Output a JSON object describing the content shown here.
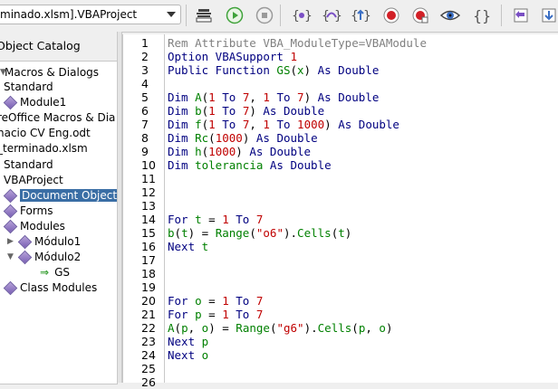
{
  "toolbar": {
    "module_selector_value": "minado.xlsm].VBAProject",
    "buttons": [
      {
        "name": "compile-button",
        "icon": "compile-icon"
      },
      {
        "name": "run-button",
        "icon": "run-icon"
      },
      {
        "name": "stop-button",
        "icon": "stop-icon"
      },
      {
        "name": "step-into-button",
        "icon": "step-into-icon"
      },
      {
        "name": "step-over-button",
        "icon": "step-over-icon"
      },
      {
        "name": "step-out-button",
        "icon": "step-out-icon"
      },
      {
        "name": "breakpoint-button",
        "icon": "breakpoint-icon"
      },
      {
        "name": "manage-breakpoints-button",
        "icon": "manage-breakpoints-icon"
      },
      {
        "name": "enable-watch-button",
        "icon": "watch-icon"
      },
      {
        "name": "find-parentheses-button",
        "icon": "brackets-icon"
      },
      {
        "name": "insert-button",
        "icon": "insert-icon"
      },
      {
        "name": "save-button",
        "icon": "save-icon"
      }
    ],
    "colors": {
      "run": "#3fa23a",
      "stop": "#9a9a9a",
      "breakpoint": "#d22027",
      "step": "#7a4fc4"
    }
  },
  "catalog": {
    "title": "Object Catalog",
    "items": [
      {
        "label": "Macros & Dialogs",
        "icon": "expander-icon",
        "level": 0
      },
      {
        "label": "Standard",
        "level": 1
      },
      {
        "label": "Module1",
        "icon": "module-icon",
        "level": 1
      },
      {
        "label": "reOffice Macros & Dia",
        "level": 0
      },
      {
        "label": "nacio CV Eng.odt",
        "level": 0
      },
      {
        "label": "_terminado.xlsm",
        "level": 0
      },
      {
        "label": "Standard",
        "level": 0
      },
      {
        "label": "VBAProject",
        "level": 0
      },
      {
        "label": "Document Objects",
        "icon": "folder-icon",
        "level": 0,
        "selected": true
      },
      {
        "label": "Forms",
        "icon": "folder-icon",
        "level": 0
      },
      {
        "label": "Modules",
        "icon": "folder-icon",
        "level": 0
      },
      {
        "label": "Módulo1",
        "icon": "module-icon",
        "level": 1
      },
      {
        "label": "Módulo2",
        "icon": "module-icon",
        "level": 1
      },
      {
        "label": "GS",
        "icon": "arrow-right-icon",
        "level": 2
      },
      {
        "label": "Class Modules",
        "icon": "folder-icon",
        "level": 0
      }
    ]
  },
  "editor": {
    "line_numbers": [
      "1",
      "2",
      "3",
      "4",
      "5",
      "6",
      "7",
      "8",
      "9",
      "10",
      "11",
      "12",
      "13",
      "14",
      "15",
      "16",
      "17",
      "18",
      "19",
      "20",
      "21",
      "22",
      "23",
      "24",
      "25",
      "26"
    ],
    "lines": [
      [
        [
          "c",
          "Rem Attribute VBA_ModuleType=VBAModule"
        ]
      ],
      [
        [
          "k",
          "Option VBASupport "
        ],
        [
          "n",
          "1"
        ]
      ],
      [
        [
          "k",
          "Public Function "
        ],
        [
          "i",
          "GS"
        ],
        [
          "o",
          "("
        ],
        [
          "i",
          "x"
        ],
        [
          "o",
          ") "
        ],
        [
          "k",
          "As Double"
        ]
      ],
      [],
      [
        [
          "k",
          "Dim "
        ],
        [
          "i",
          "A"
        ],
        [
          "o",
          "("
        ],
        [
          "n",
          "1"
        ],
        [
          "k",
          " To "
        ],
        [
          "n",
          "7"
        ],
        [
          "o",
          ", "
        ],
        [
          "n",
          "1"
        ],
        [
          "k",
          " To "
        ],
        [
          "n",
          "7"
        ],
        [
          "o",
          ") "
        ],
        [
          "k",
          "As Double"
        ]
      ],
      [
        [
          "k",
          "Dim "
        ],
        [
          "i",
          "b"
        ],
        [
          "o",
          "("
        ],
        [
          "n",
          "1"
        ],
        [
          "k",
          " To "
        ],
        [
          "n",
          "7"
        ],
        [
          "o",
          ") "
        ],
        [
          "k",
          "As Double"
        ]
      ],
      [
        [
          "k",
          "Dim "
        ],
        [
          "i",
          "f"
        ],
        [
          "o",
          "("
        ],
        [
          "n",
          "1"
        ],
        [
          "k",
          " To "
        ],
        [
          "n",
          "7"
        ],
        [
          "o",
          ", "
        ],
        [
          "n",
          "1"
        ],
        [
          "k",
          " To "
        ],
        [
          "n",
          "1000"
        ],
        [
          "o",
          ") "
        ],
        [
          "k",
          "As Double"
        ]
      ],
      [
        [
          "k",
          "Dim "
        ],
        [
          "i",
          "Rc"
        ],
        [
          "o",
          "("
        ],
        [
          "n",
          "1000"
        ],
        [
          "o",
          ") "
        ],
        [
          "k",
          "As Double"
        ]
      ],
      [
        [
          "k",
          "Dim "
        ],
        [
          "i",
          "h"
        ],
        [
          "o",
          "("
        ],
        [
          "n",
          "1000"
        ],
        [
          "o",
          ") "
        ],
        [
          "k",
          "As Double"
        ]
      ],
      [
        [
          "k",
          "Dim "
        ],
        [
          "i",
          "tolerancia"
        ],
        [
          "k",
          " As Double"
        ]
      ],
      [],
      [],
      [],
      [
        [
          "k",
          "For "
        ],
        [
          "i",
          "t"
        ],
        [
          "o",
          " = "
        ],
        [
          "n",
          "1"
        ],
        [
          "k",
          " To "
        ],
        [
          "n",
          "7"
        ]
      ],
      [
        [
          "i",
          "b"
        ],
        [
          "o",
          "("
        ],
        [
          "i",
          "t"
        ],
        [
          "o",
          ") = "
        ],
        [
          "i",
          "Range"
        ],
        [
          "o",
          "("
        ],
        [
          "s",
          "\"o6\""
        ],
        [
          "o",
          ")."
        ],
        [
          "i",
          "Cells"
        ],
        [
          "o",
          "("
        ],
        [
          "i",
          "t"
        ],
        [
          "o",
          ")"
        ]
      ],
      [
        [
          "k",
          "Next "
        ],
        [
          "i",
          "t"
        ]
      ],
      [],
      [],
      [],
      [
        [
          "k",
          "For "
        ],
        [
          "i",
          "o"
        ],
        [
          "o",
          " = "
        ],
        [
          "n",
          "1"
        ],
        [
          "k",
          " To "
        ],
        [
          "n",
          "7"
        ]
      ],
      [
        [
          "k",
          "For "
        ],
        [
          "i",
          "p"
        ],
        [
          "o",
          " = "
        ],
        [
          "n",
          "1"
        ],
        [
          "k",
          " To "
        ],
        [
          "n",
          "7"
        ]
      ],
      [
        [
          "i",
          "A"
        ],
        [
          "o",
          "("
        ],
        [
          "i",
          "p"
        ],
        [
          "o",
          ", "
        ],
        [
          "i",
          "o"
        ],
        [
          "o",
          ") = "
        ],
        [
          "i",
          "Range"
        ],
        [
          "o",
          "("
        ],
        [
          "s",
          "\"g6\""
        ],
        [
          "o",
          ")."
        ],
        [
          "i",
          "Cells"
        ],
        [
          "o",
          "("
        ],
        [
          "i",
          "p"
        ],
        [
          "o",
          ", "
        ],
        [
          "i",
          "o"
        ],
        [
          "o",
          ")"
        ]
      ],
      [
        [
          "k",
          "Next "
        ],
        [
          "i",
          "p"
        ]
      ],
      [
        [
          "k",
          "Next "
        ],
        [
          "i",
          "o"
        ]
      ],
      [],
      []
    ]
  }
}
